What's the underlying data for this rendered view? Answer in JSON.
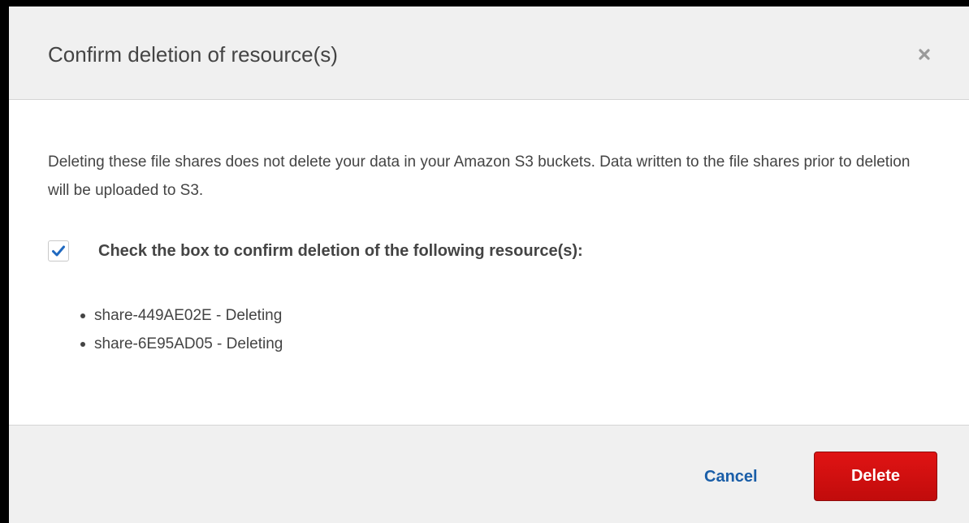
{
  "dialog": {
    "title": "Confirm deletion of resource(s)",
    "close_icon": "close-icon",
    "description": "Deleting these file shares does not delete your data in your Amazon S3 buckets. Data written to the file shares prior to deletion will be uploaded to S3.",
    "confirm": {
      "checked": true,
      "label": "Check the box to confirm deletion of the following resource(s):"
    },
    "resources": [
      "share-449AE02E - Deleting",
      "share-6E95AD05 - Deleting"
    ],
    "buttons": {
      "cancel_label": "Cancel",
      "delete_label": "Delete"
    }
  },
  "colors": {
    "header_bg": "#f0f0f0",
    "text": "#444444",
    "link": "#1a5ea8",
    "danger": "#d01010",
    "check": "#1f69c0"
  }
}
